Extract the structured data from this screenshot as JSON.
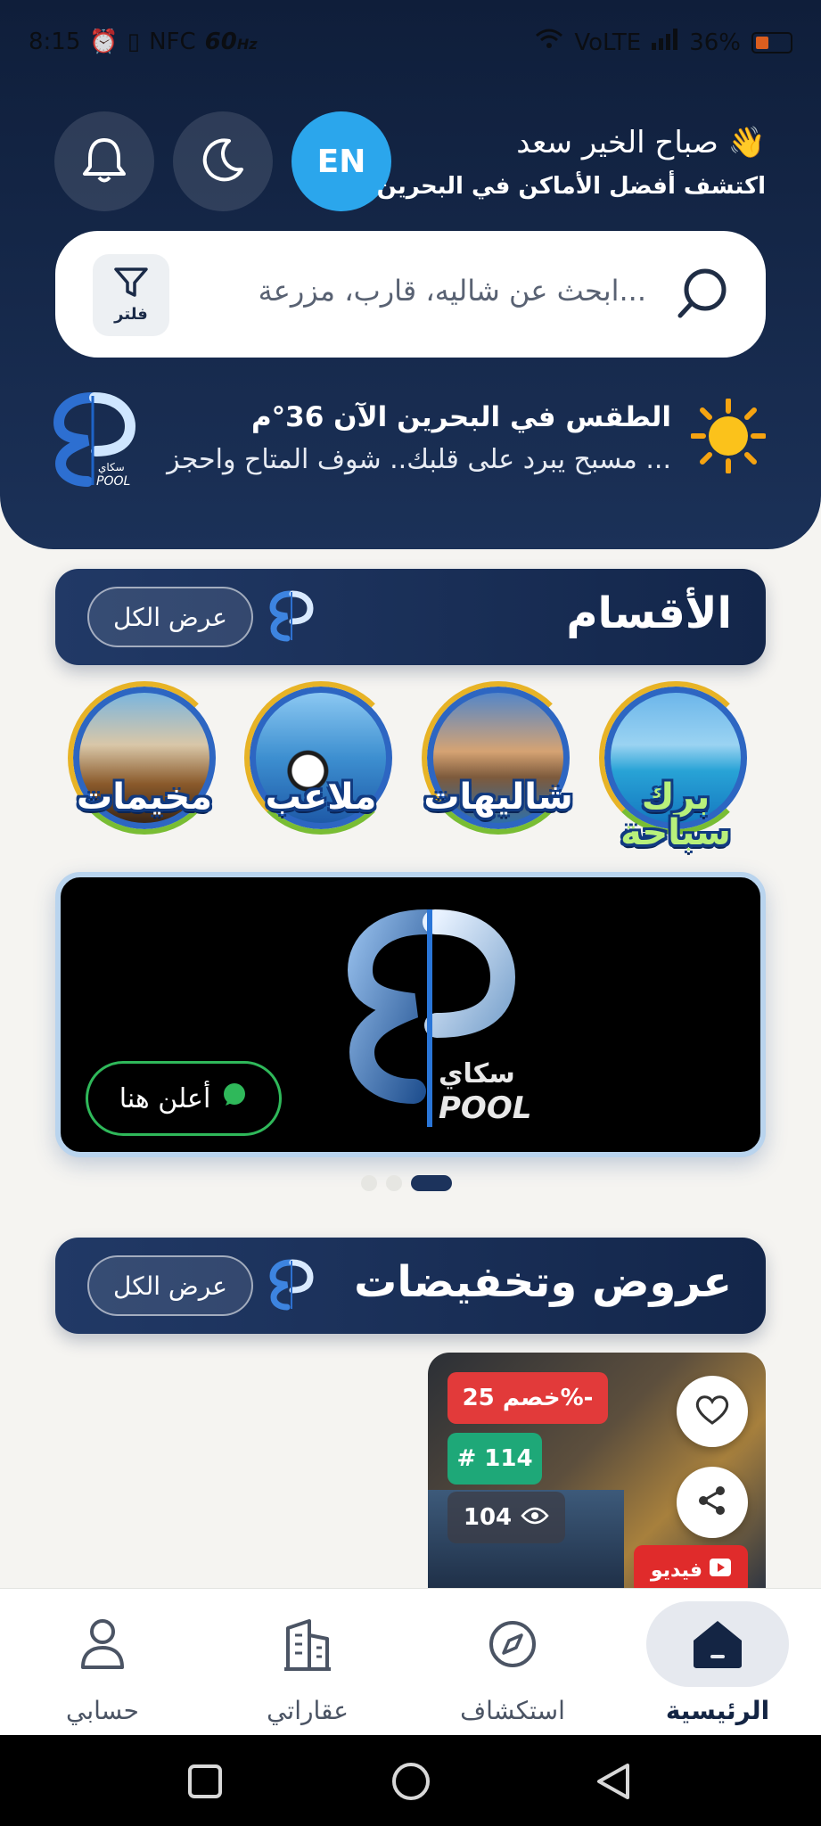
{
  "status_bar": {
    "time": "8:15",
    "nfc": "NFC",
    "speed": "60",
    "speed_unit": "Hz",
    "network": "VoLTE",
    "battery": "36%"
  },
  "header": {
    "lang_button": "EN",
    "greeting": "صباح الخير سعد 👋",
    "subtitle": "اكتشف أفضل الأماكن في البحرين",
    "search_placeholder": "ابحث عن شاليه، قارب، مزرعة...",
    "filter_label": "فلتر",
    "weather_title": "الطقس في البحرين الآن 36°م",
    "weather_sub": "مسبح يبرد على قلبك.. شوف المتاح واحجز ..."
  },
  "categories_section": {
    "title": "الأقسام",
    "view_all": "عرض الكل",
    "items": [
      {
        "name": "برك سباحة"
      },
      {
        "name": "شاليهات"
      },
      {
        "name": "ملاعب"
      },
      {
        "name": "مخيمات"
      }
    ]
  },
  "banner": {
    "advertise_label": "أعلن هنا",
    "brand_ar": "سكاي",
    "brand_en": "POOL",
    "slides_total": 3,
    "active_slide": 3
  },
  "offers_section": {
    "title": "عروض وتخفيضات",
    "view_all": "عرض الكل",
    "card": {
      "discount": "خصم 25%-",
      "number": "# 114",
      "views": "104",
      "video_label": "فيديو"
    }
  },
  "bottom_nav": {
    "items": [
      {
        "label": "الرئيسية",
        "icon": "home-icon"
      },
      {
        "label": "استكشاف",
        "icon": "compass-icon"
      },
      {
        "label": "عقاراتي",
        "icon": "building-icon"
      },
      {
        "label": "حسابي",
        "icon": "user-icon"
      }
    ]
  },
  "colors": {
    "header_bg": "#0f1e3a",
    "accent_blue": "#2ba6ec",
    "discount_red": "#e23a3a",
    "number_green": "#1ea878"
  }
}
